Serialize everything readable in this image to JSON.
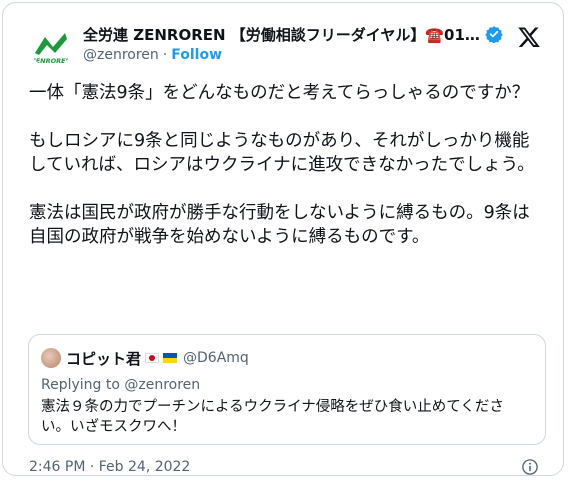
{
  "author": {
    "display_name": "全労連 ZENROREN 【労働相談フリーダイヤル】☎️0120-3...",
    "handle": "@zenroren",
    "separator": "·",
    "follow_label": "Follow",
    "logo_text": "ZENROREN"
  },
  "tweet": {
    "text": "一体「憲法9条」をどんなものだと考えてらっしゃるのですか？\n\nもしロシアに9条と同じようなものがあり、それがしっかり機能していれば、ロシアはウクライナに進攻できなかったでしょう。\n\n憲法は国民が政府が勝手な行動をしないように縛るもの。9条は自国の政府が戦争を始めないように縛るものです。"
  },
  "quote": {
    "name": "コピット君",
    "handle": "@D6Amq",
    "replying_to": "Replying to @zenroren",
    "text": "憲法９条の力でプーチンによるウクライナ侵略をぜひ食い止めてください。いざモスクワへ！"
  },
  "meta": {
    "timestamp": "2:46 PM · Feb 24, 2022"
  },
  "colors": {
    "accent": "#1d9bf0",
    "logo_green": "#1a9a3a",
    "text": "#0f1419",
    "muted": "#536471",
    "border": "#cfd9de"
  },
  "icons": [
    "verified-badge-icon",
    "x-logo-icon",
    "info-icon",
    "japan-flag-icon",
    "ukraine-flag-icon"
  ]
}
